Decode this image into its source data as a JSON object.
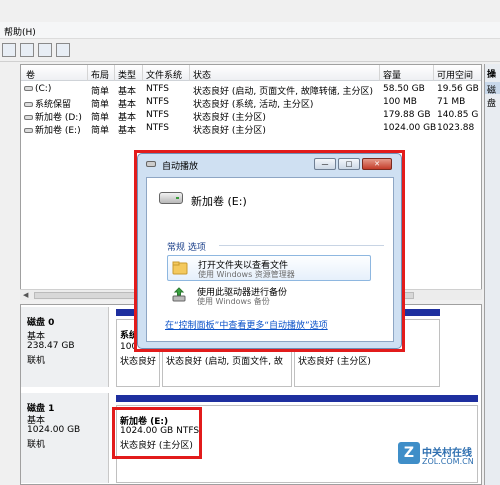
{
  "menu": {
    "help": "帮助(H)"
  },
  "volume_table": {
    "headers": [
      "卷",
      "布局",
      "类型",
      "文件系统",
      "状态",
      "容量",
      "可用空间"
    ],
    "rows": [
      {
        "vol": "(C:)",
        "layout": "简单",
        "type": "基本",
        "fs": "NTFS",
        "status": "状态良好 (启动, 页面文件, 故障转储, 主分区)",
        "capacity": "58.50 GB",
        "free": "19.56 GB"
      },
      {
        "vol": "系统保留",
        "layout": "简单",
        "type": "基本",
        "fs": "NTFS",
        "status": "状态良好 (系统, 活动, 主分区)",
        "capacity": "100 MB",
        "free": "71 MB"
      },
      {
        "vol": "新加卷 (D:)",
        "layout": "简单",
        "type": "基本",
        "fs": "NTFS",
        "status": "状态良好 (主分区)",
        "capacity": "179.88 GB",
        "free": "140.85 G"
      },
      {
        "vol": "新加卷 (E:)",
        "layout": "简单",
        "type": "基本",
        "fs": "NTFS",
        "status": "状态良好 (主分区)",
        "capacity": "1024.00 GB",
        "free": "1023.88"
      }
    ]
  },
  "right_pane": {
    "header": "操作",
    "item": "磁盘"
  },
  "disks": [
    {
      "name": "磁盘 0",
      "type": "基本",
      "size": "238.47 GB",
      "state": "联机",
      "partitions": [
        {
          "name": "系统",
          "line2": "100",
          "line3": "状态良好"
        },
        {
          "name": "",
          "line2": "",
          "line3": "状态良好 (启动, 页面文件, 故"
        },
        {
          "name": "",
          "line2": "",
          "line3": "状态良好 (主分区)"
        }
      ]
    },
    {
      "name": "磁盘 1",
      "type": "基本",
      "size": "1024.00 GB",
      "state": "联机",
      "partitions": [
        {
          "name": "新加卷  (E:)",
          "line2": "1024.00 GB NTFS",
          "line3": "状态良好 (主分区)"
        }
      ]
    }
  ],
  "dialog": {
    "title": "自动播放",
    "drive": "新加卷 (E:)",
    "section": "常规 选项",
    "options": [
      {
        "main": "打开文件夹以查看文件",
        "sub": "使用 Windows 资源管理器"
      },
      {
        "main": "使用此驱动器进行备份",
        "sub": "使用 Windows 备份"
      }
    ],
    "link": "在“控制面板”中查看更多“自动播放”选项"
  },
  "watermark": {
    "text": "中关村在线",
    "sub": "ZOL.COM.CN"
  },
  "colors": {
    "highlight_red": "#e21b1b",
    "partition_bar": "#1e2f9f",
    "link": "#0b52c9"
  }
}
